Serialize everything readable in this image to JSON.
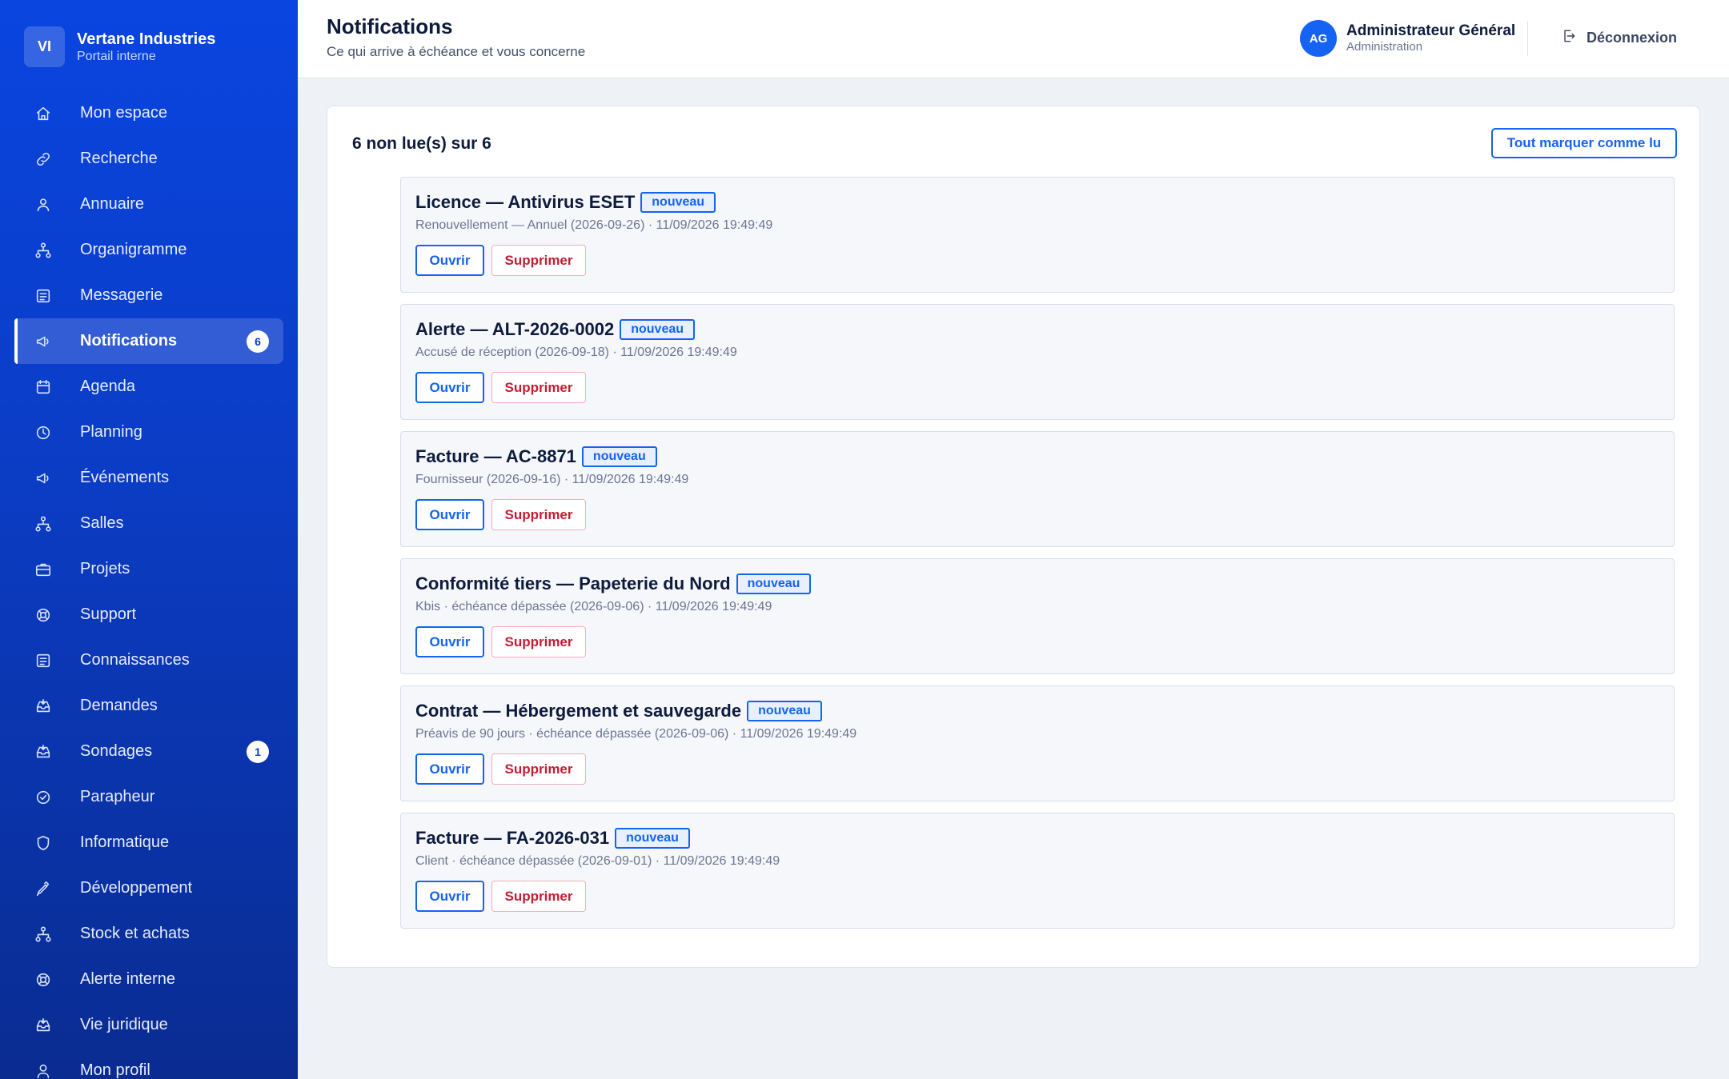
{
  "brand": {
    "initials": "VI",
    "name": "Vertane Industries",
    "subtitle": "Portail interne"
  },
  "sidebar": {
    "items": [
      {
        "label": "Mon espace",
        "icon": "home-icon"
      },
      {
        "label": "Recherche",
        "icon": "link-icon"
      },
      {
        "label": "Annuaire",
        "icon": "users-icon"
      },
      {
        "label": "Organigramme",
        "icon": "org-chart-icon"
      },
      {
        "label": "Messagerie",
        "icon": "document-icon"
      },
      {
        "label": "Notifications",
        "icon": "megaphone-icon",
        "badge": "6",
        "active": true
      },
      {
        "label": "Agenda",
        "icon": "calendar-icon"
      },
      {
        "label": "Planning",
        "icon": "clock-icon"
      },
      {
        "label": "Événements",
        "icon": "megaphone-icon"
      },
      {
        "label": "Salles",
        "icon": "org-chart-icon"
      },
      {
        "label": "Projets",
        "icon": "briefcase-icon"
      },
      {
        "label": "Support",
        "icon": "lifebuoy-icon"
      },
      {
        "label": "Connaissances",
        "icon": "document-icon"
      },
      {
        "label": "Demandes",
        "icon": "inbox-icon"
      },
      {
        "label": "Sondages",
        "icon": "inbox-icon",
        "badge": "1"
      },
      {
        "label": "Parapheur",
        "icon": "check-circle-icon"
      },
      {
        "label": "Informatique",
        "icon": "shield-icon"
      },
      {
        "label": "Développement",
        "icon": "pen-icon"
      },
      {
        "label": "Stock et achats",
        "icon": "org-chart-icon"
      },
      {
        "label": "Alerte interne",
        "icon": "lifebuoy-icon"
      },
      {
        "label": "Vie juridique",
        "icon": "inbox-icon"
      },
      {
        "label": "Mon profil",
        "icon": "user-icon"
      }
    ]
  },
  "header": {
    "title": "Notifications",
    "subtitle": "Ce qui arrive à échéance et vous concerne",
    "user": {
      "initials": "AG",
      "name": "Administrateur Général",
      "role": "Administration"
    },
    "logout_label": "Déconnexion"
  },
  "main": {
    "count_label": "6 non lue(s) sur 6",
    "mark_all_label": "Tout marquer comme lu",
    "open_label": "Ouvrir",
    "delete_label": "Supprimer",
    "notifications": [
      {
        "title": "Licence — Antivirus ESET",
        "tag": "nouveau",
        "meta": "Renouvellement — Annuel (2026-09-26) · 11/09/2026 19:49:49"
      },
      {
        "title": "Alerte — ALT-2026-0002",
        "tag": "nouveau",
        "meta": "Accusé de réception (2026-09-18) · 11/09/2026 19:49:49"
      },
      {
        "title": "Facture — AC-8871",
        "tag": "nouveau",
        "meta": "Fournisseur (2026-09-16) · 11/09/2026 19:49:49"
      },
      {
        "title": "Conformité tiers — Papeterie du Nord",
        "tag": "nouveau",
        "meta": "Kbis · échéance dépassée (2026-09-06) · 11/09/2026 19:49:49"
      },
      {
        "title": "Contrat — Hébergement et sauvegarde",
        "tag": "nouveau",
        "meta": "Préavis de 90 jours · échéance dépassée (2026-09-06) · 11/09/2026 19:49:49"
      },
      {
        "title": "Facture — FA-2026-031",
        "tag": "nouveau",
        "meta": "Client · échéance dépassée (2026-09-01) · 11/09/2026 19:49:49"
      }
    ]
  }
}
